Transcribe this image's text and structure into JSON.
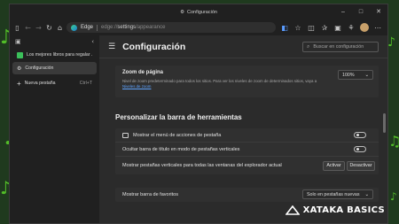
{
  "window": {
    "title": "Configuración"
  },
  "toolbar": {
    "brand": "Edge",
    "url_prefix": "edge://",
    "url_path": "settings",
    "url_suffix": "/appearance"
  },
  "sidebar": {
    "tabs": [
      {
        "label": "Los mejores libros para regalar ...",
        "favicon_color": "#3bbf5a",
        "active": false
      },
      {
        "label": "Configuración",
        "favicon_color": "#9a9a9a",
        "active": true
      }
    ],
    "new_tab_label": "Nueva pestaña",
    "new_tab_shortcut": "Ctrl+T"
  },
  "settings": {
    "title": "Configuración",
    "search_placeholder": "Buscar en configuración",
    "zoom": {
      "title": "Zoom de página",
      "description": "Nivel de zoom predeterminado para todos los sitios. Para ver los niveles de zoom de determinados sitios, vaya a",
      "link": "Niveles de zoom",
      "value": "100%"
    },
    "section_title": "Personalizar la barra de herramientas",
    "rows": [
      {
        "label": "Mostrar el menú de acciones de pestaña",
        "has_icon": true
      },
      {
        "label": "Ocultar barra de título en modo de pestañas verticales",
        "has_icon": false
      },
      {
        "label": "Mostrar pestañas verticales para todas las ventanas del explorador actual",
        "has_icon": false
      }
    ],
    "activate_button": "Activar",
    "deactivate_button": "Desactivar",
    "favorites_label": "Mostrar barra de favoritos",
    "favorites_value": "Solo en pestañas nuevas"
  },
  "watermark": {
    "text": "XATAKA BASICS"
  },
  "colors": {
    "accent_link": "#5ea3ff",
    "wallpaper": "#1f3a1e",
    "glyph": "#5cd62a"
  }
}
